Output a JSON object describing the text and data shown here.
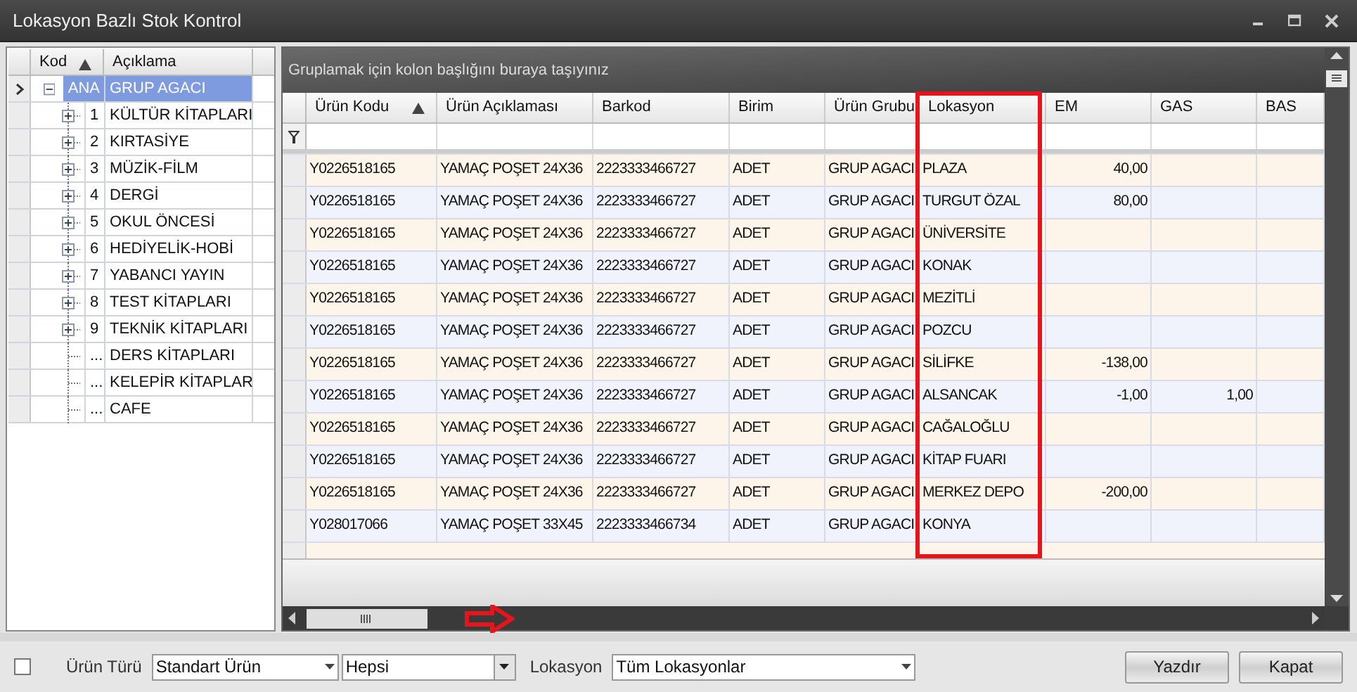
{
  "window": {
    "title": "Lokasyon Bazlı Stok Kontrol"
  },
  "tree": {
    "columns": [
      {
        "label": "Kod",
        "sorted": true
      },
      {
        "label": "Açıklama",
        "sorted": false
      }
    ],
    "rows": [
      {
        "code": "ANA",
        "label": "GRUP AGACI",
        "selected": true,
        "expanded": true,
        "children": [
          {
            "code": "1",
            "label": "KÜLTÜR KİTAPLARI",
            "selected": false,
            "expanded": false,
            "has_children": true
          },
          {
            "code": "2",
            "label": "KIRTASİYE",
            "selected": false,
            "expanded": false,
            "has_children": true
          },
          {
            "code": "3",
            "label": "MÜZİK-FİLM",
            "selected": false,
            "expanded": false,
            "has_children": true
          },
          {
            "code": "4",
            "label": "DERGİ",
            "selected": false,
            "expanded": false,
            "has_children": true
          },
          {
            "code": "5",
            "label": "OKUL ÖNCESİ",
            "selected": false,
            "expanded": false,
            "has_children": true
          },
          {
            "code": "6",
            "label": "HEDİYELİK-HOBİ",
            "selected": false,
            "expanded": false,
            "has_children": true
          },
          {
            "code": "7",
            "label": "YABANCI YAYIN",
            "selected": false,
            "expanded": false,
            "has_children": true
          },
          {
            "code": "8",
            "label": "TEST KİTAPLARI",
            "selected": false,
            "expanded": false,
            "has_children": true
          },
          {
            "code": "9",
            "label": "TEKNİK KİTAPLARI",
            "selected": false,
            "expanded": false,
            "has_children": true
          },
          {
            "code": "...",
            "label": "DERS KİTAPLARI",
            "selected": false,
            "has_children": false
          },
          {
            "code": "...",
            "label": "KELEPİR KİTAPLAR",
            "selected": false,
            "has_children": false
          },
          {
            "code": "...",
            "label": "CAFE",
            "selected": false,
            "has_children": false
          }
        ]
      }
    ]
  },
  "grid": {
    "group_panel_hint": "Gruplamak için kolon başlığını buraya taşıyınız",
    "columns": [
      {
        "label": "Ürün Kodu",
        "sorted": true,
        "numeric": false,
        "highlighted": false
      },
      {
        "label": "Ürün Açıklaması",
        "sorted": false,
        "numeric": false,
        "highlighted": false
      },
      {
        "label": "Barkod",
        "sorted": false,
        "numeric": false,
        "highlighted": false
      },
      {
        "label": "Birim",
        "sorted": false,
        "numeric": false,
        "highlighted": false
      },
      {
        "label": "Ürün Grubu",
        "sorted": false,
        "numeric": false,
        "highlighted": false
      },
      {
        "label": "Lokasyon",
        "sorted": false,
        "numeric": false,
        "highlighted": true
      },
      {
        "label": "EM",
        "sorted": false,
        "numeric": true,
        "highlighted": false
      },
      {
        "label": "GAS",
        "sorted": false,
        "numeric": true,
        "highlighted": false
      },
      {
        "label": "BAS",
        "sorted": false,
        "highlighted": false
      }
    ],
    "rows": [
      [
        "Y0226518165",
        "YAMAÇ POŞET 24X36",
        "2223333466727",
        "ADET",
        "GRUP AGACI",
        "PLAZA",
        "40,00",
        "",
        ""
      ],
      [
        "Y0226518165",
        "YAMAÇ POŞET 24X36",
        "2223333466727",
        "ADET",
        "GRUP AGACI",
        "TURGUT ÖZAL",
        "80,00",
        "",
        ""
      ],
      [
        "Y0226518165",
        "YAMAÇ POŞET 24X36",
        "2223333466727",
        "ADET",
        "GRUP AGACI",
        "ÜNİVERSİTE",
        "",
        "",
        ""
      ],
      [
        "Y0226518165",
        "YAMAÇ POŞET 24X36",
        "2223333466727",
        "ADET",
        "GRUP AGACI",
        "KONAK",
        "",
        "",
        ""
      ],
      [
        "Y0226518165",
        "YAMAÇ POŞET 24X36",
        "2223333466727",
        "ADET",
        "GRUP AGACI",
        "MEZİTLİ",
        "",
        "",
        ""
      ],
      [
        "Y0226518165",
        "YAMAÇ POŞET 24X36",
        "2223333466727",
        "ADET",
        "GRUP AGACI",
        "POZCU",
        "",
        "",
        ""
      ],
      [
        "Y0226518165",
        "YAMAÇ POŞET 24X36",
        "2223333466727",
        "ADET",
        "GRUP AGACI",
        "SİLİFKE",
        "-138,00",
        "",
        ""
      ],
      [
        "Y0226518165",
        "YAMAÇ POŞET 24X36",
        "2223333466727",
        "ADET",
        "GRUP AGACI",
        "ALSANCAK",
        "-1,00",
        "1,00",
        ""
      ],
      [
        "Y0226518165",
        "YAMAÇ POŞET 24X36",
        "2223333466727",
        "ADET",
        "GRUP AGACI",
        "CAĞALOĞLU",
        "",
        "",
        ""
      ],
      [
        "Y0226518165",
        "YAMAÇ POŞET 24X36",
        "2223333466727",
        "ADET",
        "GRUP AGACI",
        "KİTAP FUARI",
        "",
        "",
        ""
      ],
      [
        "Y0226518165",
        "YAMAÇ POŞET 24X36",
        "2223333466727",
        "ADET",
        "GRUP AGACI",
        "MERKEZ DEPO",
        "-200,00",
        "",
        ""
      ],
      [
        "Y028017066",
        "YAMAÇ POŞET 33X45",
        "2223333466734",
        "ADET",
        "GRUP AGACI",
        "KONYA",
        "",
        "",
        ""
      ]
    ]
  },
  "footer": {
    "checkbox": {
      "checked": false
    },
    "product_type_label": "Ürün Türü",
    "product_type": "Standart Ürün",
    "product_filter": "Hepsi",
    "location_label": "Lokasyon",
    "location": "Tüm Lokasyonlar",
    "buttons": [
      "Yazdır",
      "Kapat"
    ]
  }
}
